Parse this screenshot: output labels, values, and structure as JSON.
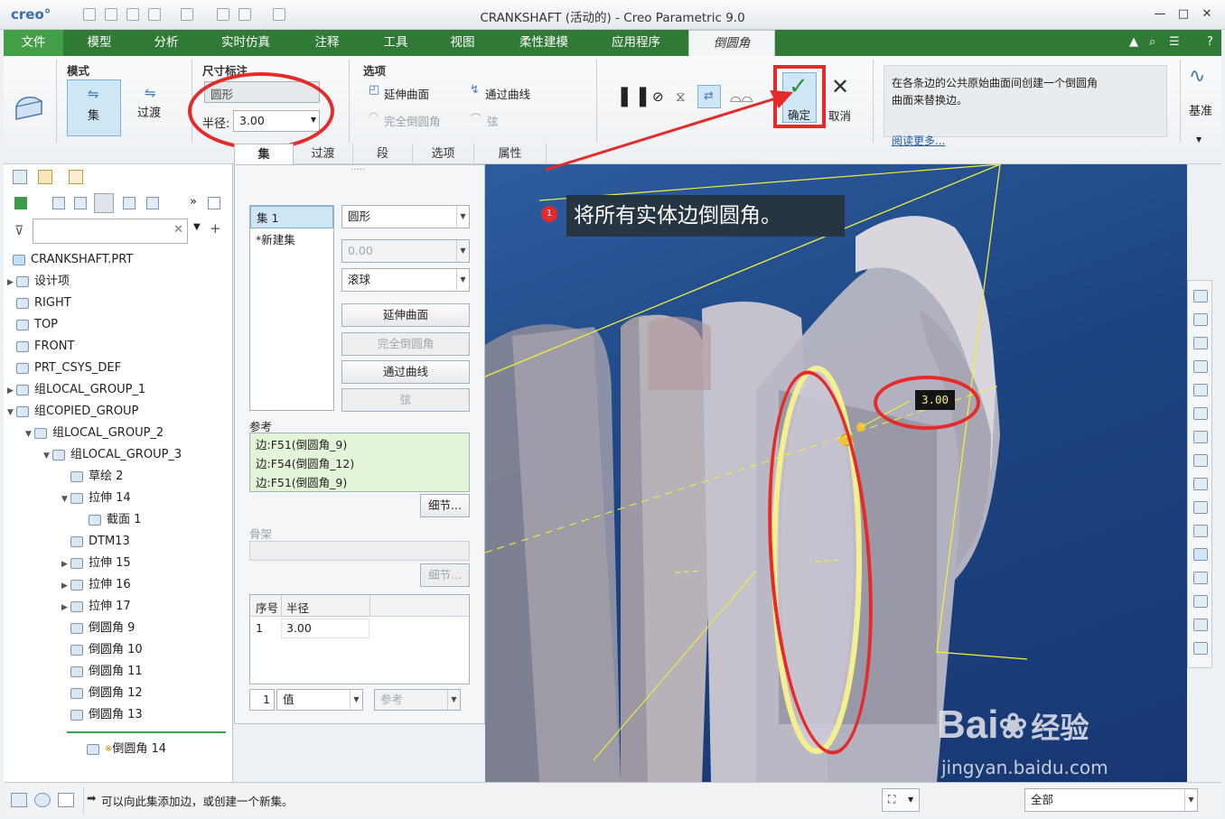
{
  "app": {
    "logo": "creo°",
    "window_title": "CRANKSHAFT (活动的) - Creo Parametric 9.0"
  },
  "menubar": {
    "items": [
      "文件",
      "模型",
      "分析",
      "实时仿真",
      "注释",
      "工具",
      "视图",
      "柔性建模",
      "应用程序",
      "倒圆角"
    ]
  },
  "ribbon": {
    "mode_label": "模式",
    "set_label": "集",
    "transition_label": "过渡",
    "dim_label": "尺寸标注",
    "shape_value": "圆形",
    "radius_label": "半径:",
    "radius_value": "3.00",
    "options_label": "选项",
    "extend_surfaces": "延伸曲面",
    "through_curve": "通过曲线",
    "full_round": "完全倒圆角",
    "chord": "弦",
    "ok_label": "确定",
    "cancel_label": "取消",
    "help_text": "在各条边的公共原始曲面间创建一个倒圆角曲面来替换边。",
    "read_more": "阅读更多...",
    "datum_label": "基准",
    "tabs": [
      "集",
      "过渡",
      "段",
      "选项",
      "属性"
    ]
  },
  "tree": {
    "root": "CRANKSHAFT.PRT",
    "items": [
      {
        "label": "设计项",
        "level": 1,
        "expand": "▶"
      },
      {
        "label": "RIGHT",
        "level": 1,
        "expand": ""
      },
      {
        "label": "TOP",
        "level": 1,
        "expand": ""
      },
      {
        "label": "FRONT",
        "level": 1,
        "expand": ""
      },
      {
        "label": "PRT_CSYS_DEF",
        "level": 1,
        "expand": ""
      },
      {
        "label": "组LOCAL_GROUP_1",
        "level": 1,
        "expand": "▶"
      },
      {
        "label": "组COPIED_GROUP",
        "level": 1,
        "expand": "▼"
      },
      {
        "label": "组LOCAL_GROUP_2",
        "level": 2,
        "expand": "▼"
      },
      {
        "label": "组LOCAL_GROUP_3",
        "level": 3,
        "expand": "▼"
      },
      {
        "label": "草绘 2",
        "level": 4,
        "expand": ""
      },
      {
        "label": "拉伸 14",
        "level": 4,
        "expand": "▼"
      },
      {
        "label": "截面 1",
        "level": 5,
        "expand": ""
      },
      {
        "label": "DTM13",
        "level": 4,
        "expand": ""
      },
      {
        "label": "拉伸 15",
        "level": 4,
        "expand": "▶"
      },
      {
        "label": "拉伸 16",
        "level": 4,
        "expand": "▶"
      },
      {
        "label": "拉伸 17",
        "level": 4,
        "expand": "▶"
      },
      {
        "label": "倒圆角 9",
        "level": 4,
        "expand": ""
      },
      {
        "label": "倒圆角 10",
        "level": 4,
        "expand": ""
      },
      {
        "label": "倒圆角 11",
        "level": 4,
        "expand": ""
      },
      {
        "label": "倒圆角 12",
        "level": 4,
        "expand": ""
      },
      {
        "label": "倒圆角 13",
        "level": 4,
        "expand": ""
      }
    ],
    "new_item": "倒圆角 14",
    "new_mark": "※"
  },
  "popup": {
    "sets": [
      "集 1",
      "*新建集"
    ],
    "shape": "圆形",
    "value": "0.00",
    "method": "滚球",
    "btn_extend": "延伸曲面",
    "btn_full": "完全倒圆角",
    "btn_curve": "通过曲线",
    "btn_chord": "弦",
    "ref_label": "参考",
    "refs": [
      "边:F51(倒圆角_9)",
      "边:F54(倒圆角_12)",
      "边:F51(倒圆角_9)"
    ],
    "details": "细节...",
    "skeleton_label": "骨架",
    "details2": "细节...",
    "table_headers": [
      "序号",
      "半径"
    ],
    "table_rows": [
      {
        "no": "1",
        "radius": "3.00"
      }
    ],
    "bottom_num": "1",
    "bottom_value": "值",
    "bottom_ref": "参考"
  },
  "viewport": {
    "callout_number": "1",
    "callout_text": "将所有实体边倒圆角。",
    "dim_tag": "3.00",
    "watermark": "Bai",
    "watermark_brand": "经验",
    "watermark_url": "jingyan.baidu.com"
  },
  "status": {
    "message": "可以向此集添加边，或创建一个新集。",
    "filter": "全部"
  },
  "colors": {
    "accent_green": "#2f7a34",
    "highlight_red": "#e52a2a",
    "viewport_blue": "#1d4482"
  }
}
